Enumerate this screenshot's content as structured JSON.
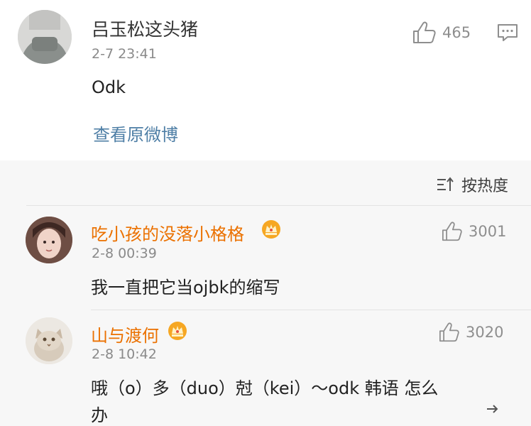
{
  "main_post": {
    "username": "吕玉松这头猪",
    "time": "2-7 23:41",
    "content": "Odk",
    "likes": "465",
    "view_original": "查看原微博"
  },
  "sort_label": "按热度",
  "comments": [
    {
      "username": "吃小孩的没落小格格",
      "time": "2-8 00:39",
      "content": "我一直把它当ojbk的缩写",
      "likes": "3001"
    },
    {
      "username": "山与渡何",
      "time": "2-8 10:42",
      "content": "哦（o）多（duo）尅（kei）～odk 韩语 怎么",
      "content_line2": "办",
      "likes": "3020"
    }
  ],
  "colors": {
    "username_vip": "#eb7100",
    "link": "#4f7fa6",
    "meta": "#8a8a8a"
  },
  "icons": [
    "like-icon",
    "comment-icon",
    "sort-icon",
    "crown-badge-icon",
    "reply-arrow-icon"
  ]
}
